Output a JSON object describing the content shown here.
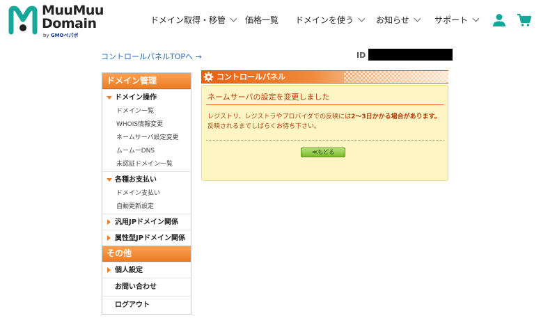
{
  "header": {
    "logo": {
      "line1": "MuuMuu",
      "line2": "Domain",
      "by": "by",
      "brand": "GMOペパボ"
    },
    "nav": [
      {
        "label": "ドメイン取得・移管",
        "chevron": true
      },
      {
        "label": "価格一覧",
        "chevron": false
      },
      {
        "label": "ドメインを使う",
        "chevron": true
      },
      {
        "label": "お知らせ",
        "chevron": true
      },
      {
        "label": "サポート",
        "chevron": true
      }
    ],
    "icons": {
      "user": "user-icon",
      "cart": "cart-icon"
    },
    "accent": "#14a89a"
  },
  "top": {
    "control_panel_link": "コントロールパネルTOPへ →",
    "id_label": "ID :"
  },
  "sidebar": {
    "section1": "ドメイン管理",
    "domain_ops": "ドメイン操作",
    "domain_ops_items": [
      "ドメイン一覧",
      "WHOIS情報変更",
      "ネームサーバ設定変更",
      "ムームーDNS",
      "未認証ドメイン一覧"
    ],
    "payments": "各種お支払い",
    "payments_items": [
      "ドメイン支払い",
      "自動更新設定"
    ],
    "generic_jp": "汎用JPドメイン関係",
    "attr_jp": "属性型JPドメイン関係",
    "section2": "その他",
    "personal": "個人設定",
    "contact": "お問い合わせ",
    "logout": "ログアウト"
  },
  "panel": {
    "title": "コントロールパネル",
    "message_title": "ネームサーバの設定を変更しました",
    "body_pre": "レジストリ、レジストラやプロバイダでの反映には",
    "body_bold": "2〜3日かかる場合があります。",
    "body_post": "反映されるまでしばらくお待ち下さい。",
    "back_button": "≪もどる",
    "accent": "#ee7d22"
  }
}
